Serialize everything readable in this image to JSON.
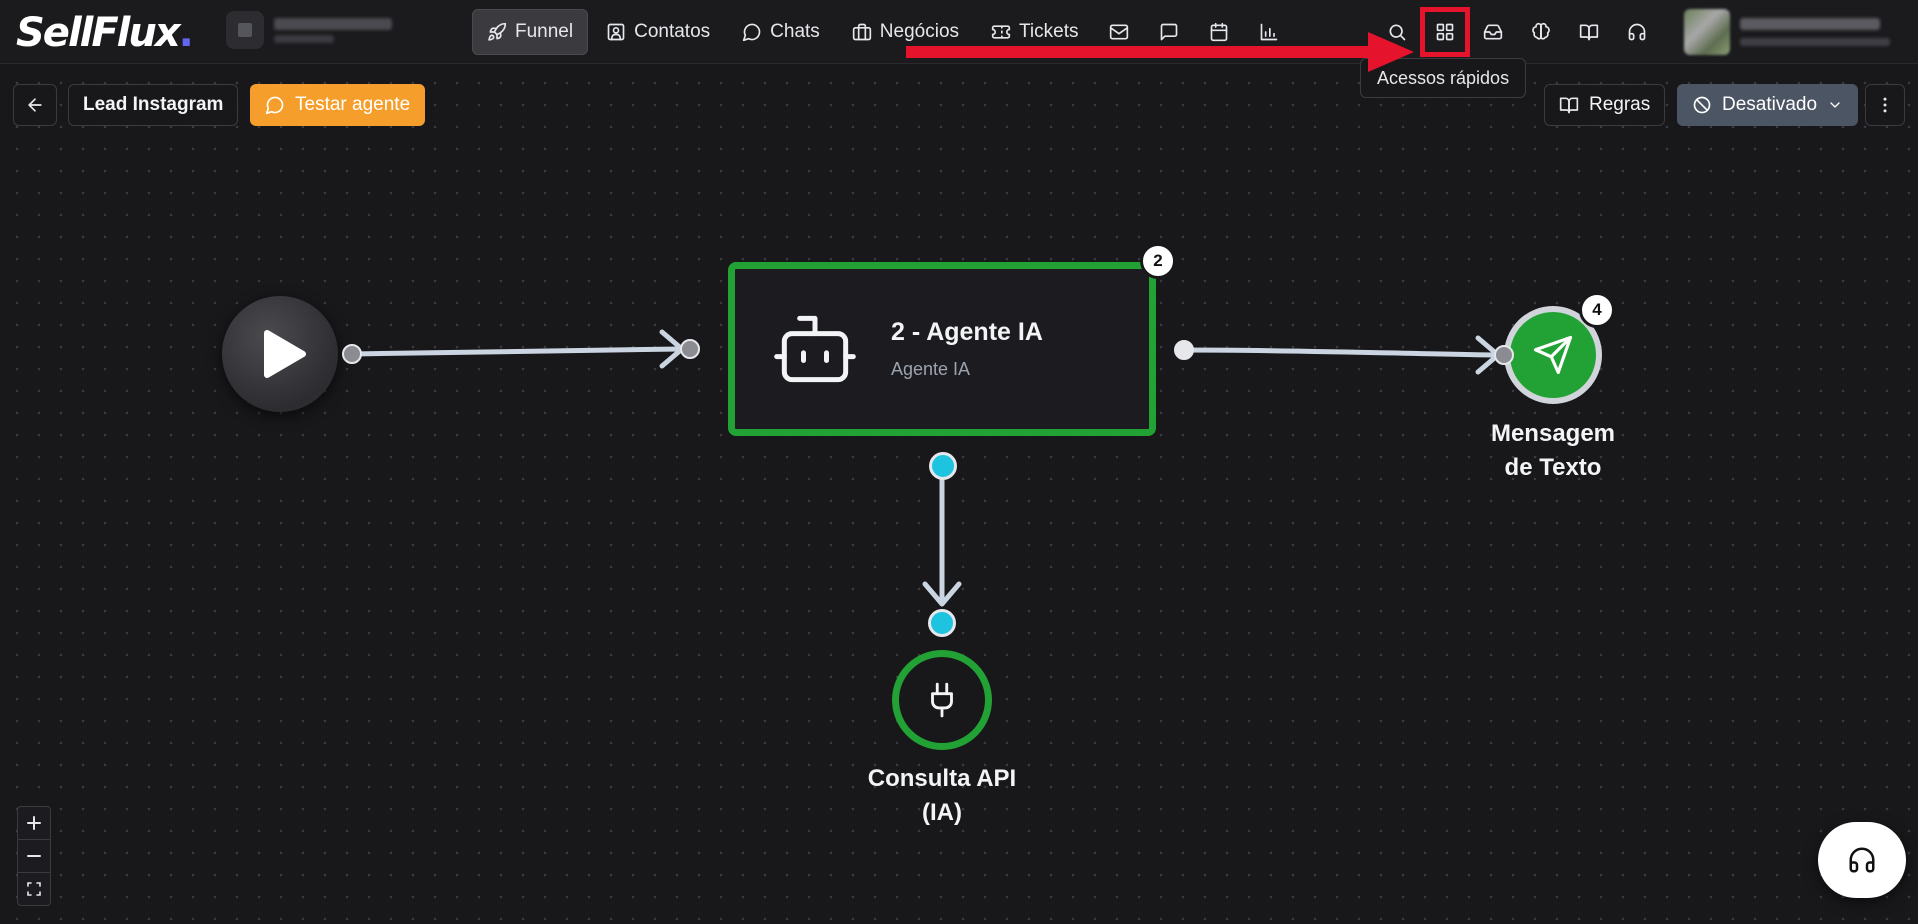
{
  "app": {
    "logo_text": "SellFlux",
    "logo_dot": "."
  },
  "nav": {
    "funnel": "Funnel",
    "contacts": "Contatos",
    "chats": "Chats",
    "deals": "Negócios",
    "tickets": "Tickets"
  },
  "tooltip": {
    "quick_access": "Acessos rápidos"
  },
  "toolbar": {
    "flow_name": "Lead Instagram",
    "test_agent": "Testar agente",
    "rules": "Regras",
    "status": "Desativado"
  },
  "nodes": {
    "agent": {
      "badge": "2",
      "title": "2 - Agente IA",
      "subtitle": "Agente IA"
    },
    "message": {
      "badge": "4",
      "label_line1": "Mensagem",
      "label_line2": "de Texto"
    },
    "api": {
      "label_line1": "Consulta API",
      "label_line2": "(IA)"
    }
  },
  "colors": {
    "accent_orange": "#f59e2b",
    "node_green": "#22a234",
    "handle_cyan": "#1ec3e0",
    "highlight_red": "#e5132b",
    "status_gray": "#4b5563"
  }
}
